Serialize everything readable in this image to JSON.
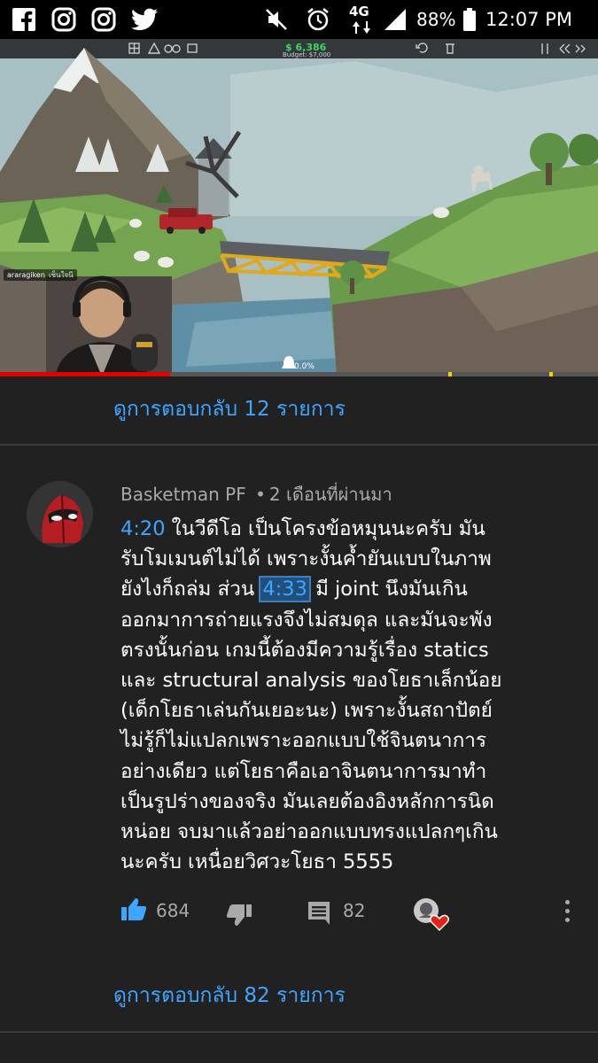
{
  "status_bar": {
    "apps": [
      "facebook-icon",
      "instagram-icon",
      "instagram-icon",
      "twitter-icon"
    ],
    "network": "4G",
    "battery": "88%",
    "time": "12:07 PM"
  },
  "video": {
    "money": "$ 6,386",
    "budget": "Budget: $7,000",
    "streamer_name": "araragiken",
    "streamer_sub": "เซ็นใจนี",
    "completion": "0.0%",
    "progress": 0.285
  },
  "replies_top": {
    "label": "ดูการตอบกลับ 12 รายการ"
  },
  "comment": {
    "author": "Basketman PF",
    "separator": "•",
    "time_ago": "2 เดือนที่ผ่านมา",
    "lines": [
      {
        "ts": "4:20",
        "text": " ในวีดีโอ เป็นโครงข้อหมุนนะครับ มัน"
      },
      {
        "text": "รับโมเมนต์ไม่ได้ เพราะงั้นค้ำยันแบบในภาพ"
      },
      {
        "pre": "ยังไงก็ถล่ม ส่วน ",
        "ts": "4:33",
        "text": " มี joint นึงมันเกิน"
      },
      {
        "text": "ออกมาการถ่ายแรงจึงไม่สมดุล และมันจะพัง"
      },
      {
        "text": "ตรงนั้นก่อน เกมนี้ต้องมีความรู้เรื่อง statics"
      },
      {
        "text": "และ structural analysis ของโยธาเล็กน้อย"
      },
      {
        "text": "(เด็กโยธาเล่นกันเยอะนะ) เพราะงั้นสถาปัตย์"
      },
      {
        "text": "ไม่รู้ก็ไม่แปลกเพราะออกแบบใช้จินตนาการ"
      },
      {
        "text": "อย่างเดียว แต่โยธาคือเอาจินตนาการมาทำ"
      },
      {
        "text": "เป็นรูปร่างของจริง มันเลยต้องอิงหลักการนิด"
      },
      {
        "text": "หน่อย จบมาแล้วอย่าออกแบบทรงแปลกๆเกิน"
      },
      {
        "text": "นะครับ เหนื่อยวิศวะโยธา 5555"
      }
    ],
    "likes": "684",
    "replies_count": "82"
  },
  "replies_bottom": {
    "label": "ดูการตอบกลับ 82 รายการ"
  },
  "colors": {
    "link": "#3ea6ff",
    "progress": "#e00000",
    "background": "#212121"
  }
}
